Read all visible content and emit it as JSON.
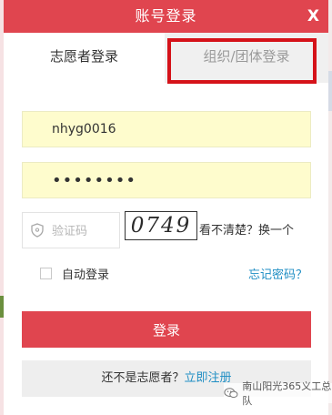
{
  "dialog": {
    "title": "账号登录",
    "close_label": "X"
  },
  "tabs": [
    {
      "label": "志愿者登录",
      "active": true
    },
    {
      "label": "组织/团体登录",
      "active": false,
      "highlighted": true
    }
  ],
  "form": {
    "username_value": "nhyg0016",
    "password_value": "••••••••",
    "captcha_placeholder": "验证码",
    "captcha_image_text": "0749",
    "captcha_refresh_label": "看不清楚？换一个",
    "remember_label": "自动登录",
    "remember_checked": false,
    "forgot_label": "忘记密码？",
    "login_button_label": "登录",
    "register_prompt": "还不是志愿者？",
    "register_link_label": "立即注册"
  },
  "watermark": {
    "text": "南山阳光365义工总队"
  },
  "colors": {
    "brand": "#e0454f",
    "link": "#1f8ec4",
    "input_background": "#fefccd",
    "highlight_border": "#d51219"
  },
  "icons": {
    "close": "close-icon",
    "captcha_field": "shield-icon",
    "watermark": "wechat-logo-icon"
  }
}
